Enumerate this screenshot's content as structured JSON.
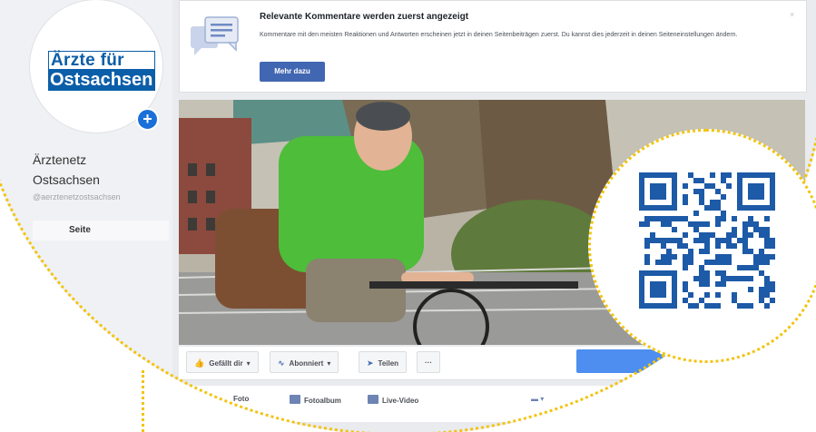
{
  "sidebar": {
    "logo_line1": "Ärzte für",
    "logo_line2": "Ostsachsen",
    "page_name_line1": "Ärztenetz",
    "page_name_line2": "Ostsachsen",
    "page_handle": "@aerztenetzostsachsen",
    "nav_item": "Seite"
  },
  "notice": {
    "title": "Relevante Kommentare werden zuerst angezeigt",
    "text": "Kommentare mit den meisten Reaktionen und Antworten erscheinen jetzt in deinen Seitenbeiträgen zuerst. Du kannst dies jederzeit in deinen Seiteneinstellungen ändern.",
    "button": "Mehr dazu",
    "close": "×"
  },
  "actions": {
    "like": "Gefällt dir",
    "follow": "Abonniert",
    "share": "Teilen",
    "more": "···"
  },
  "composer": {
    "item1": "Foto",
    "item2": "Fotoalbum",
    "item3": "Live-Video"
  },
  "colors": {
    "accent": "#4267b2",
    "highlight_dots": "#f2c40f",
    "logo_blue": "#0b5ea8",
    "qr_blue": "#1d5aa7"
  }
}
